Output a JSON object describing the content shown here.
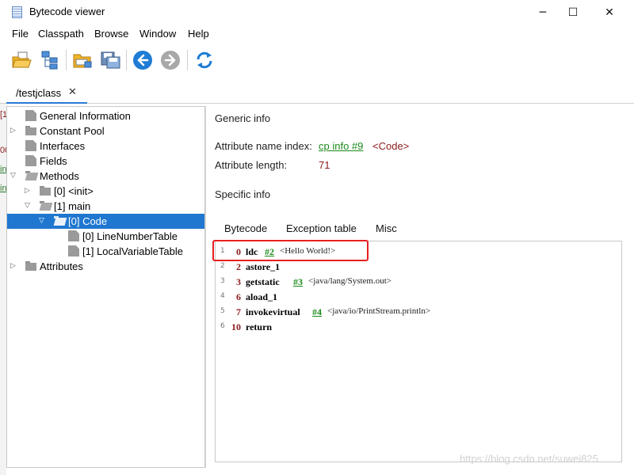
{
  "window": {
    "title": "Bytecode viewer",
    "controls": {
      "minimize": "─",
      "maximize": "☐",
      "close": "✕"
    }
  },
  "menu": [
    "File",
    "Classpath",
    "Browse",
    "Window",
    "Help"
  ],
  "toolbar": {
    "buttons": [
      "open-file-icon",
      "classpath-tree-icon",
      "open-folder-icon",
      "save-icon",
      "back-arrow-icon",
      "forward-arrow-icon",
      "reload-icon"
    ],
    "accent": "#1f7cd4"
  },
  "tab": {
    "label": "/testjclass",
    "close": "✕"
  },
  "tree": {
    "items": [
      {
        "label": "General Information",
        "type": "file",
        "expanded": null
      },
      {
        "label": "Constant Pool",
        "type": "folder",
        "expanded": false
      },
      {
        "label": "Interfaces",
        "type": "file",
        "expanded": null
      },
      {
        "label": "Fields",
        "type": "file",
        "expanded": null
      },
      {
        "label": "Methods",
        "type": "folder",
        "expanded": true
      },
      {
        "label": "[0] <init>",
        "type": "folder",
        "expanded": false
      },
      {
        "label": "[1] main",
        "type": "folder",
        "expanded": true
      },
      {
        "label": "[0] Code",
        "type": "folder",
        "expanded": true,
        "selected": true
      },
      {
        "label": "[0] LineNumberTable",
        "type": "file",
        "expanded": null
      },
      {
        "label": "[1] LocalVariableTable",
        "type": "file",
        "expanded": null
      },
      {
        "label": "Attributes",
        "type": "folder",
        "expanded": false
      }
    ],
    "selected_color": "#1f77d0"
  },
  "detail": {
    "generic_title": "Generic info",
    "attr_name_label": "Attribute name index:",
    "attr_name_link": "cp info #9",
    "attr_name_value": "<Code>",
    "attr_length_label": "Attribute length:",
    "attr_length_value": "71",
    "specific_title": "Specific info",
    "subtabs": [
      "Bytecode",
      "Exception table",
      "Misc"
    ]
  },
  "bytecode": [
    {
      "line": "1",
      "offset": "0",
      "op": "ldc",
      "arg": "#2",
      "comment": "<Hello World!>"
    },
    {
      "line": "2",
      "offset": "2",
      "op": "astore_1",
      "arg": "",
      "comment": ""
    },
    {
      "line": "3",
      "offset": "3",
      "op": "getstatic",
      "arg": "#3",
      "comment": "<java/lang/System.out>"
    },
    {
      "line": "4",
      "offset": "6",
      "op": "aload_1",
      "arg": "",
      "comment": ""
    },
    {
      "line": "5",
      "offset": "7",
      "op": "invokevirtual",
      "arg": "#4",
      "comment": "<java/io/PrintStream.println>"
    },
    {
      "line": "6",
      "offset": "10",
      "op": "return",
      "arg": "",
      "comment": ""
    }
  ],
  "side_strip": [
    "[1",
    "00",
    "in",
    "in"
  ],
  "watermark": "https://blog.csdn.net/suwei825"
}
